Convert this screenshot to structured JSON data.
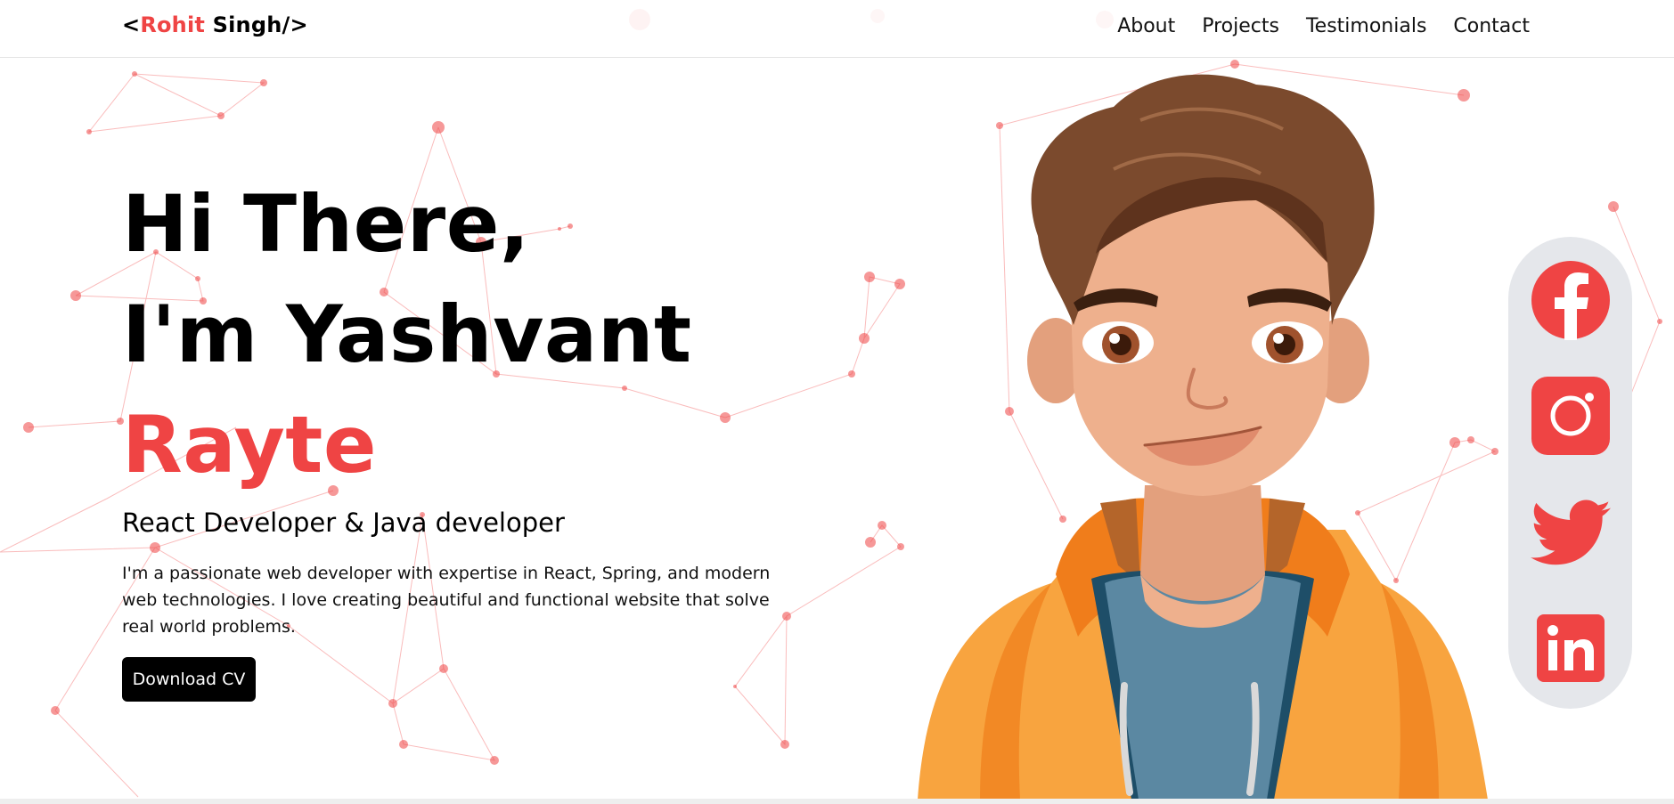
{
  "navbar": {
    "logo_open": "<",
    "logo_first": "Rohit",
    "logo_last": " Singh/>",
    "links": [
      "About",
      "Projects",
      "Testimonials",
      "Contact"
    ]
  },
  "hero": {
    "line1": "Hi There,",
    "line2": "I'm Yashvant",
    "line3": "Rayte",
    "role": "React Developer & Java developer",
    "bio": "I'm a passionate web developer with expertise in React, Spring, and modern web technologies. I love creating beautiful and functional website that solve real world problems.",
    "cv_button": "Download CV"
  },
  "social": [
    {
      "name": "facebook-icon"
    },
    {
      "name": "instagram-icon"
    },
    {
      "name": "twitter-icon"
    },
    {
      "name": "linkedin-icon"
    }
  ],
  "colors": {
    "accent": "#ef4444",
    "button_bg": "#000000",
    "social_bar_bg": "#e5e7eb"
  }
}
